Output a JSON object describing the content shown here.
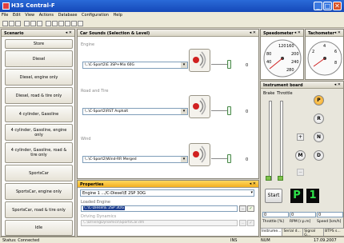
{
  "window": {
    "title": "H3S Central-F",
    "min": "_",
    "max": "□",
    "close": "✕"
  },
  "menu": [
    "File",
    "Edit",
    "View",
    "Actions",
    "Database",
    "Configuration",
    "Help"
  ],
  "scenario": {
    "title": "Scenario",
    "pins": "◂ ✕",
    "buttons": [
      "Store",
      "Diesel",
      "Diesel, engine only",
      "Diesel, road & tire only",
      "4 cylinder, Gasoline",
      "4 cylinder, Gasoline, engine only",
      "4 cylinder, Gasoline, road & tire only",
      "SportsCar",
      "SportsCar, engine only",
      "SportsCar, road & tire only",
      "Idle"
    ]
  },
  "carsounds": {
    "title": "Car Sounds (Selection & Level)",
    "pins": "◂ ✕",
    "rows": [
      {
        "label": "Engine",
        "value": "\\..\\C-Sport2\\E 3SP+Mix 60G",
        "level": "0"
      },
      {
        "label": "Road and Tire",
        "value": "\\..\\C-Sport2\\RST Asphalt",
        "level": "0"
      },
      {
        "label": "Wind",
        "value": "\\..\\C-Sport2\\Wind-RR Merged",
        "level": "0"
      }
    ]
  },
  "properties": {
    "title": "Properties",
    "pins": "◂ ✕",
    "selector": "Engine 1 .../C-Diesel\\E 2SP 3OG",
    "loaded_label": "Loaded Engine",
    "loaded_value": "\\..\\C-Diesel\\E 2SP 3OG",
    "driving_label": "Driving Dynamics",
    "driving_value": "\\..\\DrivingDynamics\\SportsCar.dm"
  },
  "speedometer": {
    "title": "Speedometer",
    "pins": "◂ ✕",
    "ticks": [
      "120",
      "160",
      "80",
      "200",
      "40",
      "240",
      "280"
    ]
  },
  "tachometer": {
    "title": "Tachometer",
    "pins": "◂ ✕",
    "ticks": [
      "4",
      "6",
      "2",
      "8"
    ]
  },
  "instrument": {
    "title": "Instrument board",
    "pins": "◂ ✕",
    "brake_label": "Brake",
    "throttle_label": "Throttle",
    "gears": [
      "P",
      "R",
      "N",
      "D"
    ],
    "m_label": "M",
    "plus": "+",
    "minus": "−",
    "start_label": "Start",
    "gear_display": "P",
    "gear_number": "1",
    "readout_values": [
      "0",
      "0",
      "0"
    ],
    "readout_labels": [
      "Throttle [%]",
      "RPM [r.p.m]",
      "Speed [km/h]"
    ],
    "tabs": [
      "Instrume...",
      "Serial d...",
      "Signal G...",
      "BTPS s..."
    ],
    "brake_fill": 0.0,
    "throttle_fill": 0.0
  },
  "status": {
    "left": "Status: Connected",
    "ins": "INS",
    "num": "NUM",
    "date": "17.09.2007"
  },
  "colors": {
    "title_bar": "#1f5fd1",
    "properties_header": "#f3b021",
    "gear_active": "#f3a81f",
    "display_green": "#2fe24a"
  }
}
